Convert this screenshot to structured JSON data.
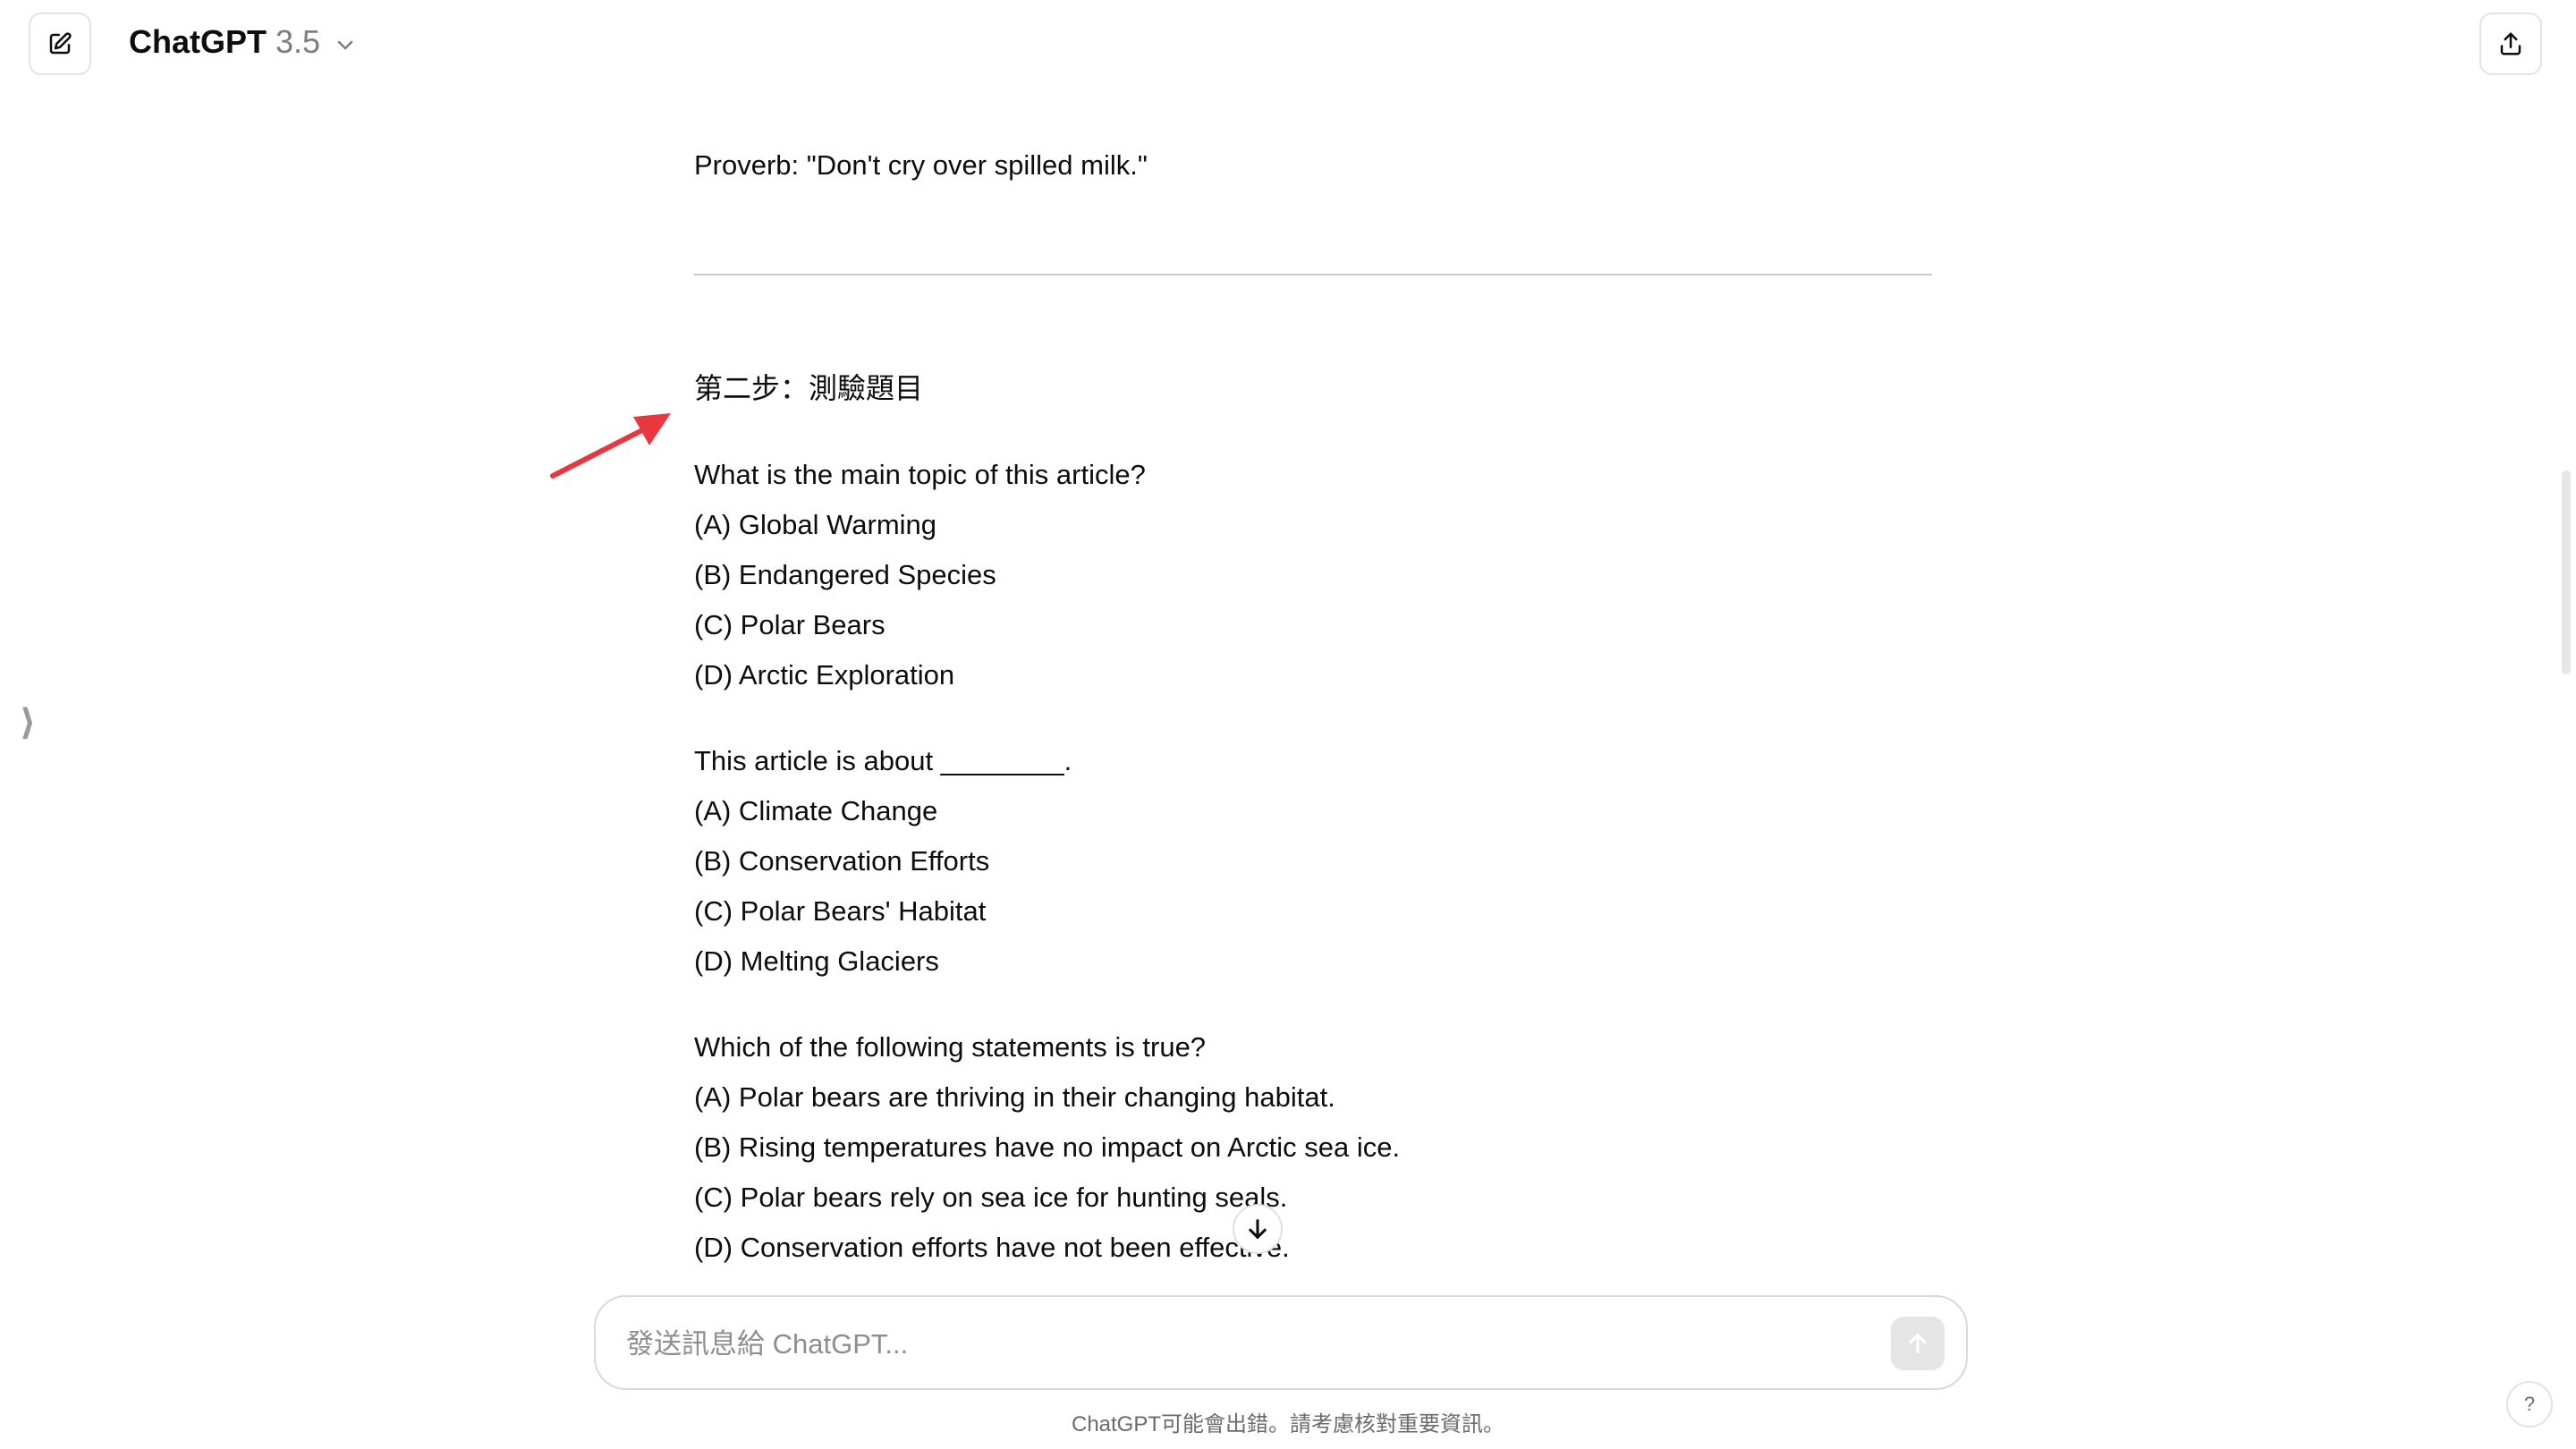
{
  "header": {
    "model_name": "ChatGPT",
    "model_version": "3.5",
    "icons": {
      "new_chat": "edit-pencil-icon",
      "share": "share-upload-icon",
      "model_dropdown": "chevron-down-icon"
    }
  },
  "sidebar": {
    "toggle_glyph": "⟩"
  },
  "conversation": {
    "proverb": "Proverb: \"Don't cry over spilled milk.\"",
    "step_heading": "第二步：測驗題目",
    "questions": [
      {
        "prompt": "What is the main topic of this article?",
        "options": [
          "(A) Global Warming",
          "(B) Endangered Species",
          "(C) Polar Bears",
          "(D) Arctic Exploration"
        ]
      },
      {
        "prompt": "This article is about ________.",
        "options": [
          "(A) Climate Change",
          "(B) Conservation Efforts",
          "(C) Polar Bears' Habitat",
          "(D) Melting Glaciers"
        ]
      },
      {
        "prompt": "Which of the following statements is true?",
        "options": [
          "(A) Polar bears are thriving in their changing habitat.",
          "(B) Rising temperatures have no impact on Arctic sea ice.",
          "(C) Polar bears rely on sea ice for hunting seals.",
          "(D) Conservation efforts have not been effective."
        ]
      }
    ]
  },
  "composer": {
    "placeholder": "發送訊息給 ChatGPT...",
    "value": "",
    "send_icon": "arrow-up-icon",
    "scroll_icon": "arrow-down-icon"
  },
  "footer": {
    "disclaimer": "ChatGPT可能會出錯。請考慮核對重要資訊。",
    "help_label": "?"
  },
  "colors": {
    "annotation_arrow": "#e8373f",
    "send_button_disabled": "#e5e5e5",
    "divider": "#c9c9c9"
  }
}
